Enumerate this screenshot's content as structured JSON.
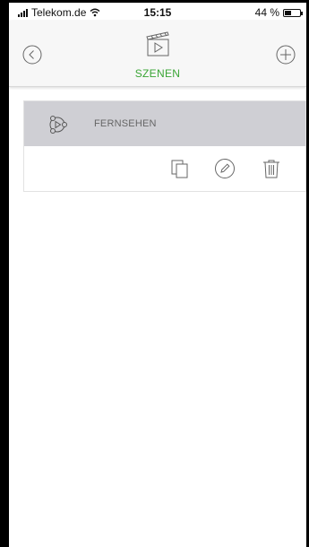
{
  "status_bar": {
    "carrier": "Telekom.de",
    "time": "15:15",
    "battery_text": "44 %",
    "battery_level_percent": 44
  },
  "nav": {
    "title": "SZENEN",
    "title_color": "#3aa535"
  },
  "scenes": [
    {
      "label": "FERNSEHEN"
    }
  ],
  "icons": {
    "back": "chevron-left-circle-icon",
    "add": "plus-circle-icon",
    "header": "clapperboard-play-icon",
    "scene": "scene-play-icon",
    "copy": "copy-icon",
    "edit": "pencil-icon",
    "delete": "trash-icon"
  }
}
